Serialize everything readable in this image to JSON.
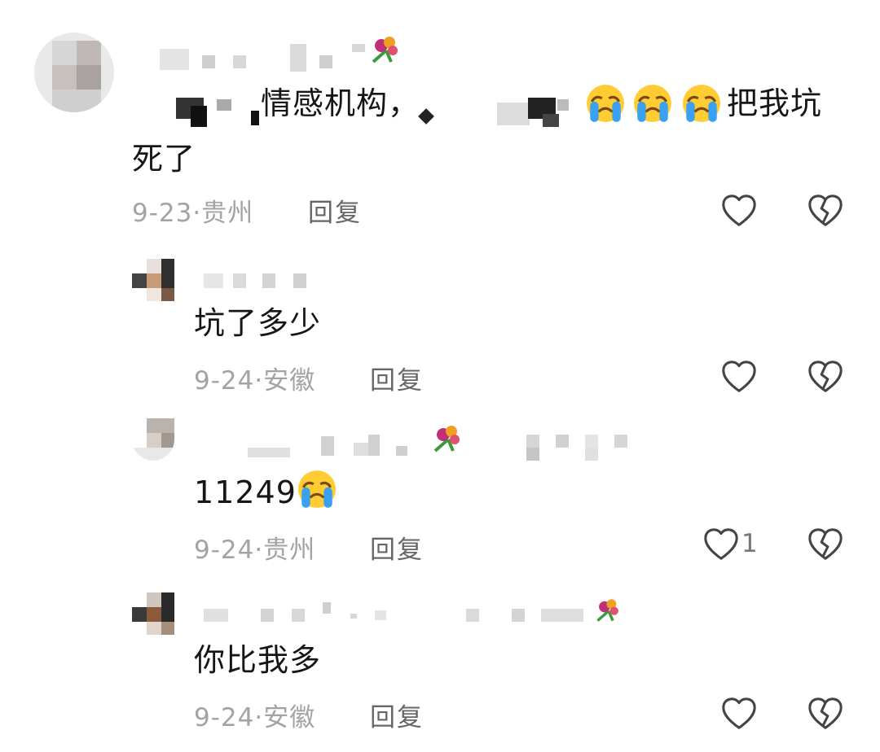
{
  "comments": [
    {
      "text_part1": "情感机构，",
      "text_part2": "把我坑",
      "text_part3": "死了",
      "date": "9-23",
      "location": "贵州",
      "reply_label": "回复"
    },
    {
      "text": "坑了多少",
      "date": "9-24",
      "location": "安徽",
      "reply_label": "回复"
    },
    {
      "text": "11249",
      "date": "9-24",
      "location": "贵州",
      "reply_label": "回复",
      "like_count": "1"
    },
    {
      "text": "你比我多",
      "date": "9-24",
      "location": "安徽",
      "reply_label": "回复"
    }
  ],
  "separator": "·",
  "icons": {
    "like": "heart-outline-icon",
    "dislike": "broken-heart-icon",
    "emoji": "loudly-crying-face-emoji",
    "flower": "bouquet-emoji"
  },
  "colors": {
    "meta": "#a3a3a3",
    "reply": "#666666",
    "icon": "#444444"
  }
}
